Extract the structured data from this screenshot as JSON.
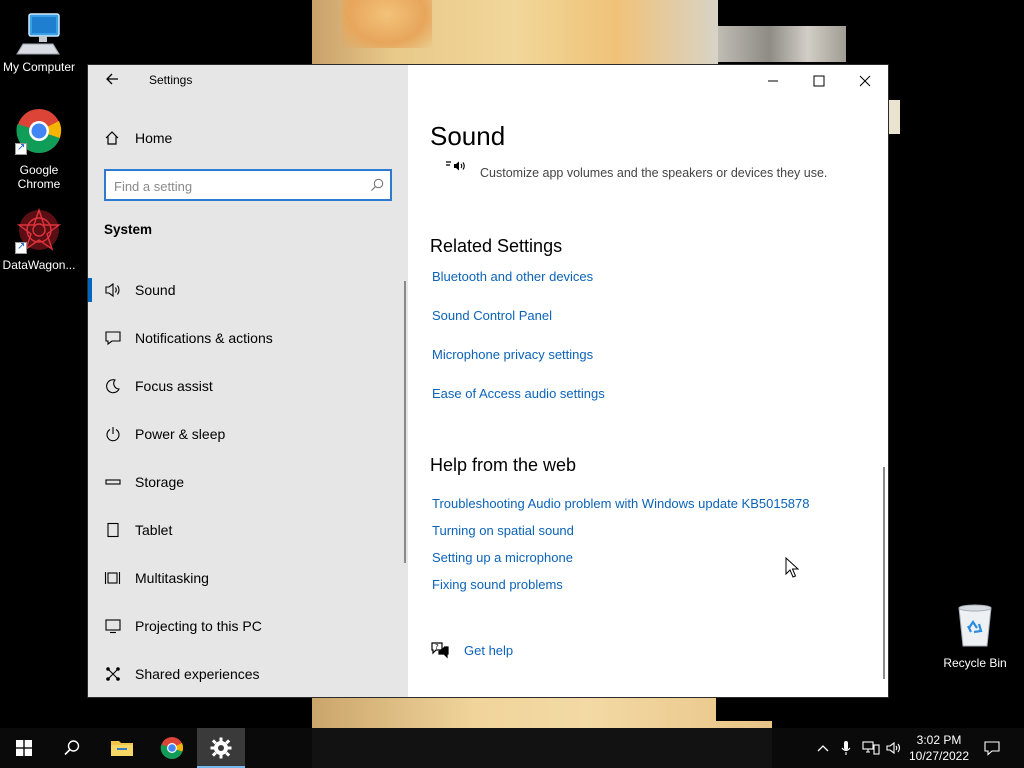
{
  "desktop": {
    "icons": [
      {
        "label": "My Computer"
      },
      {
        "label": "Google Chrome"
      },
      {
        "label": "DataWagon..."
      },
      {
        "label": "Recycle Bin"
      }
    ]
  },
  "window": {
    "title": "Settings",
    "controls": [
      "minimize-icon",
      "maximize-icon",
      "close-icon"
    ]
  },
  "sidebar": {
    "home_label": "Home",
    "search_placeholder": "Find a setting",
    "group_heading": "System",
    "items": [
      {
        "label": "Sound",
        "icon": "speaker-icon",
        "active": true
      },
      {
        "label": "Notifications & actions",
        "icon": "notifications-icon"
      },
      {
        "label": "Focus assist",
        "icon": "moon-icon"
      },
      {
        "label": "Power & sleep",
        "icon": "power-icon"
      },
      {
        "label": "Storage",
        "icon": "storage-icon"
      },
      {
        "label": "Tablet",
        "icon": "tablet-icon"
      },
      {
        "label": "Multitasking",
        "icon": "multitasking-icon"
      },
      {
        "label": "Projecting to this PC",
        "icon": "projecting-icon"
      },
      {
        "label": "Shared experiences",
        "icon": "shared-experiences-icon"
      }
    ]
  },
  "content": {
    "title": "Sound",
    "cut_row_description": "Customize app volumes and the speakers or devices they use.",
    "related_settings": {
      "heading": "Related Settings",
      "links": [
        "Bluetooth and other devices",
        "Sound Control Panel",
        "Microphone privacy settings",
        "Ease of Access audio settings"
      ]
    },
    "help_from_web": {
      "heading": "Help from the web",
      "links": [
        "Troubleshooting Audio problem with Windows update KB5015878",
        "Turning on spatial sound",
        "Setting up a microphone",
        "Fixing sound problems"
      ]
    },
    "get_help_label": "Get help"
  },
  "taskbar": {
    "apps": [
      "start-icon",
      "search-icon",
      "file-explorer-icon",
      "chrome-icon",
      "settings-icon"
    ],
    "tray_icons": [
      "chevron-up-icon",
      "microphone-icon",
      "network-icon",
      "volume-icon"
    ],
    "time": "3:02 PM",
    "date": "10/27/2022"
  },
  "colors": {
    "accent": "#0067c0",
    "link": "#0b63b8",
    "sidebar_bg": "#e6e6e6",
    "taskbar_bg": "#0a0a0a"
  }
}
